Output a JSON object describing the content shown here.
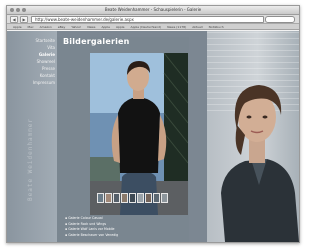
{
  "window": {
    "title": "Beate Weidenhammer - Schauspielerin - Galerie"
  },
  "toolbar": {
    "url": "http://www.beate-weidenhammer.de/galerie.aspx",
    "back": "◀",
    "forward": "▶"
  },
  "bookmarks": [
    "Apple",
    "Mac",
    "Amazon",
    "eBay",
    "Yahoo!",
    "News",
    "Apple",
    "Apple",
    "Apple (Deutschland)",
    "News (1178)",
    "Aktuell",
    "Notizbuch"
  ],
  "sidebar": {
    "items": [
      "Startseite",
      "Vita",
      "Galerie",
      "Showreel",
      "Presse",
      "Kontakt",
      "Impressum"
    ],
    "active_index": 2
  },
  "vertical_title": "Beate Weidenhammer",
  "main": {
    "heading": "Bildergalerien",
    "galleries": [
      "Galerie Colour Casual",
      "Galerie Rock und Wings",
      "Galerie Wolf Lanis vor Mobile",
      "Galerie Beschauer von Venedig"
    ]
  },
  "thumbnails": {
    "count": 9,
    "colors": [
      "#6b7c88",
      "#a08878",
      "#56606a",
      "#8a7a6c",
      "#3e4a55",
      "#9aa3aa",
      "#74655c",
      "#5c6872",
      "#8d969c"
    ]
  }
}
